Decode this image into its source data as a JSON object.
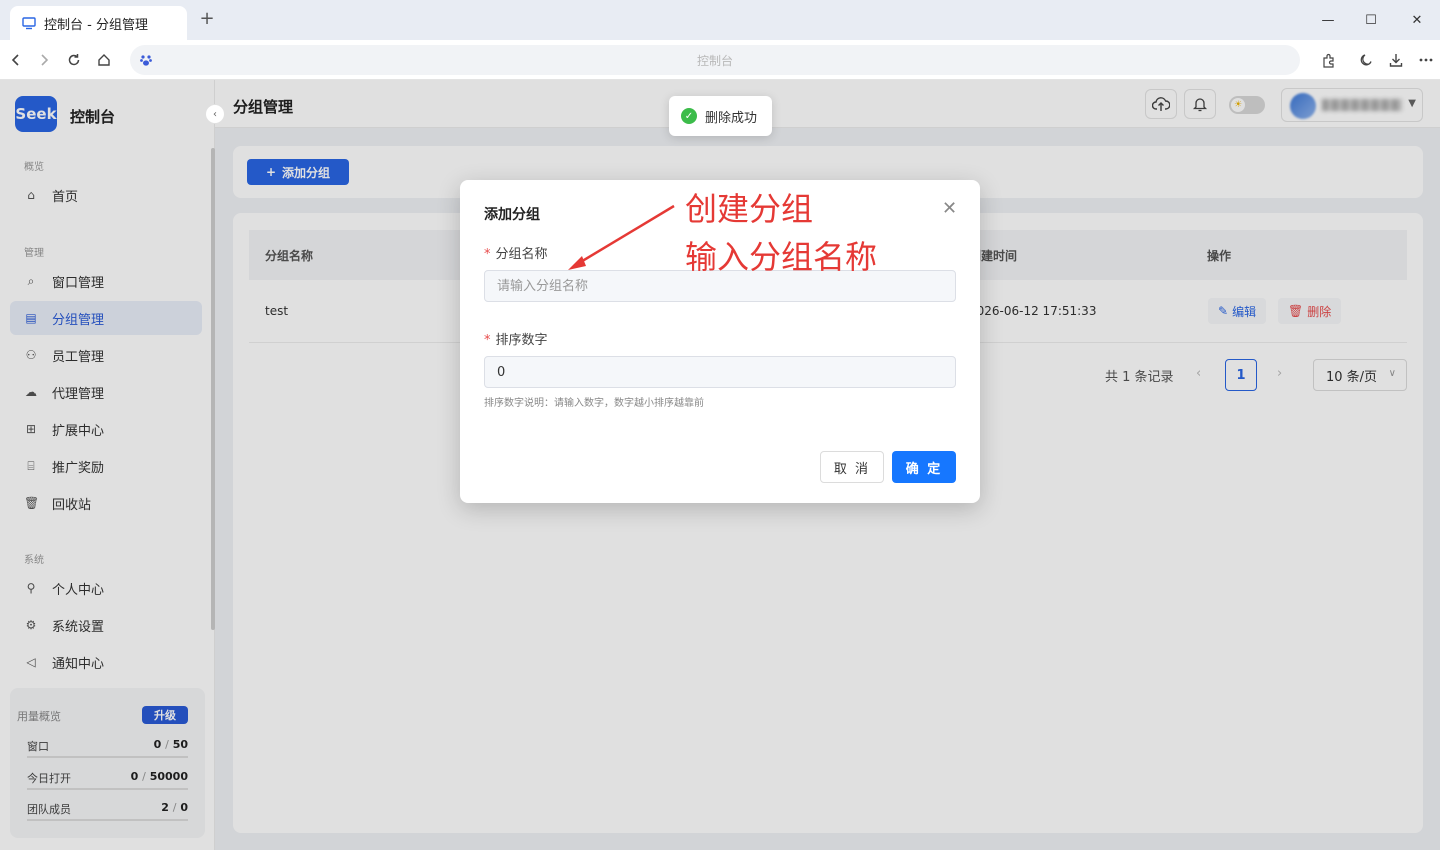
{
  "browser": {
    "tab_title": "控制台 - 分组管理",
    "tab_add": "+",
    "address": "控制台",
    "win_min": "—",
    "win_max": "☐",
    "win_close": "✕"
  },
  "sidebar": {
    "logo_text": "Seek",
    "app_name": "控制台",
    "collapse": "‹",
    "sections": {
      "overview": "概览",
      "manage": "管理",
      "system": "系统"
    },
    "items": [
      {
        "label": "首页",
        "icon": "⌂"
      },
      {
        "label": "窗口管理",
        "icon": "⌕"
      },
      {
        "label": "分组管理",
        "icon": "▤"
      },
      {
        "label": "员工管理",
        "icon": "⚇"
      },
      {
        "label": "代理管理",
        "icon": "☁"
      },
      {
        "label": "扩展中心",
        "icon": "⊞"
      },
      {
        "label": "推广奖励",
        "icon": "⌸"
      },
      {
        "label": "回收站",
        "icon": "🗑"
      },
      {
        "label": "个人中心",
        "icon": "⚲"
      },
      {
        "label": "系统设置",
        "icon": "⚙"
      },
      {
        "label": "通知中心",
        "icon": "◁"
      }
    ],
    "active_item": "分组管理",
    "usage": {
      "title": "用量概览",
      "upgrade": "升级",
      "rows": [
        {
          "label": "窗口",
          "used": "0",
          "total": "50"
        },
        {
          "label": "今日打开",
          "used": "0",
          "total": "50000"
        },
        {
          "label": "团队成员",
          "used": "2",
          "total": "0"
        }
      ]
    }
  },
  "header": {
    "title": "分组管理"
  },
  "toolbar": {
    "add_label": "添加分组"
  },
  "table": {
    "columns": [
      "分组名称",
      "创建时间",
      "操作"
    ],
    "rows": [
      {
        "name": "test",
        "created": "2026-06-12 17:51:33",
        "edit": "编辑",
        "delete": "删除"
      }
    ]
  },
  "pagination": {
    "total": "共 1 条记录",
    "current": "1",
    "page_size": "10 条/页"
  },
  "toast": {
    "message": "删除成功"
  },
  "modal": {
    "title": "添加分组",
    "name_label": "分组名称",
    "name_placeholder": "请输入分组名称",
    "name_value": "",
    "sort_label": "排序数字",
    "sort_value": "0",
    "sort_help": "排序数字说明：请输入数字，数字越小排序越靠前",
    "cancel": "取 消",
    "confirm": "确 定"
  },
  "annotation": {
    "line1": "创建分组",
    "line2": "输入分组名称",
    "color": "#e53935"
  },
  "colors": {
    "brand": "#2a66e4",
    "primary_button": "#1677ff",
    "danger": "#e84a4a",
    "success": "#3cbc4a"
  }
}
